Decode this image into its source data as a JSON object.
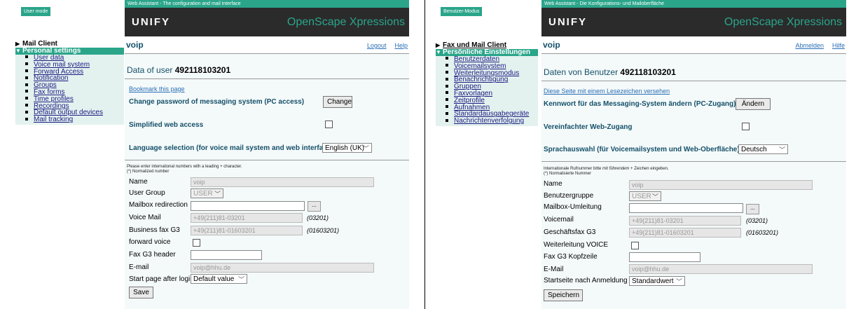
{
  "left": {
    "mode_badge": "User mode",
    "banner": "Web Assistant - The configuration and mail interface",
    "logo": "UNIFY",
    "product": "OpenScape Xpressions",
    "nav": {
      "collapsed": "Mail Client",
      "expanded": "Personal settings",
      "items": [
        "User data",
        "Voice mail system",
        "Forward Access",
        "Notification",
        "Groups",
        "Fax forms",
        "Time profiles",
        "Recordings",
        "Default output devices",
        "Mail tracking"
      ]
    },
    "page_title": "voip",
    "logout": "Logout",
    "help": "Help",
    "heading_prefix": "Data of user",
    "heading_user": "492118103201",
    "bookmark": "Bookmark this page",
    "change_pw_label": "Change password of messaging system (PC access)",
    "change_btn": "Change",
    "simplified_label": "Simplified web access",
    "language_label": "Language selection (for voice mail system and web interface)",
    "language_value": "English (UK)",
    "note1": "Please enter international numbers with a leading + character.",
    "note2": "(*) Normalized number",
    "fields": {
      "name_label": "Name",
      "name_value": "voip",
      "group_label": "User Group",
      "group_value": "USER",
      "redirect_label": "Mailbox redirection",
      "redirect_btn": "...",
      "voicemail_label": "Voice Mail",
      "voicemail_value": "+49(211)81-03201",
      "voicemail_norm": "(03201)",
      "fax_label": "Business fax G3",
      "fax_value": "+49(211)81-01603201",
      "fax_norm": "(01603201)",
      "forward_label": "forward voice",
      "faxheader_label": "Fax G3 header",
      "email_label": "E-mail",
      "email_value": "voip@hhu.de",
      "start_label": "Start page after login",
      "start_value": "Default value"
    },
    "save": "Save"
  },
  "right": {
    "mode_badge": "Benutzer-Modus",
    "banner": "Web Assistant - Die Konfigurations- und Mailoberfläche",
    "logo": "UNIFY",
    "product": "OpenScape Xpressions",
    "nav": {
      "collapsed": "Fax und Mail Client",
      "expanded": "Persönliche Einstellungen",
      "items": [
        "Benutzerdaten",
        "Voicemailsystem",
        "Weiterleitungsmodus",
        "Benachrichtigung",
        "Gruppen",
        "Faxvorlagen",
        "Zeitprofile",
        "Aufnahmen",
        "Standardausgabegeräte",
        "Nachrichtenverfolgung"
      ]
    },
    "page_title": "voip",
    "logout": "Abmelden",
    "help": "Hilfe",
    "heading_prefix": "Daten von Benutzer",
    "heading_user": "492118103201",
    "bookmark": "Diese Seite mit einem Lesezeichen versehen",
    "change_pw_label": "Kennwort für das Messaging-System ändern (PC-Zugang)",
    "change_btn": "Ändern",
    "simplified_label": "Vereinfachter Web-Zugang",
    "language_label": "Sprachauswahl (für Voicemailsystem und Web-Oberfläche)",
    "language_value": "Deutsch",
    "note1": "Internationale Rufnummer bitte mit führendem + Zeichen eingeben.",
    "note2": "(*) Normalisierte Nummer",
    "fields": {
      "name_label": "Name",
      "name_value": "voip",
      "group_label": "Benutzergruppe",
      "group_value": "USER",
      "redirect_label": "Mailbox-Umleitung",
      "redirect_btn": "...",
      "voicemail_label": "Voicemail",
      "voicemail_value": "+49(211)81-03201",
      "voicemail_norm": "(03201)",
      "fax_label": "Geschäftsfax G3",
      "fax_value": "+49(211)81-01603201",
      "fax_norm": "(01603201)",
      "forward_label": "Weiterleitung VOICE",
      "faxheader_label": "Fax G3 Kopfzeile",
      "email_label": "E-Mail",
      "email_value": "voip@hhu.de",
      "start_label": "Startseite nach Anmeldung",
      "start_value": "Standardwert"
    },
    "save": "Speichern"
  },
  "colors": {
    "accent": "#2aa58a",
    "header_bg": "#2b2b2b",
    "title": "#14506a",
    "link": "#2a6fb7"
  }
}
